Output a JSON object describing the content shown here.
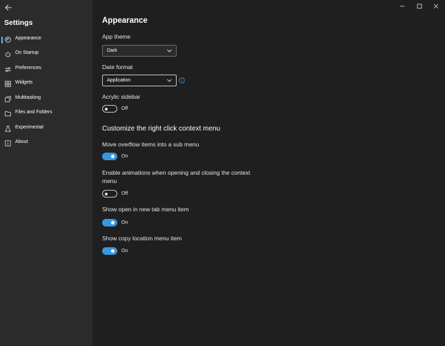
{
  "sidebar": {
    "title": "Settings",
    "items": [
      {
        "label": "Appearance",
        "icon": "appearance-icon"
      },
      {
        "label": "On Startup",
        "icon": "power-icon"
      },
      {
        "label": "Preferences",
        "icon": "sliders-icon"
      },
      {
        "label": "Widgets",
        "icon": "widgets-icon"
      },
      {
        "label": "Multitasking",
        "icon": "multitasking-icon"
      },
      {
        "label": "Files and Folders",
        "icon": "folder-icon"
      },
      {
        "label": "Experimental",
        "icon": "flask-icon"
      },
      {
        "label": "About",
        "icon": "info-square-icon"
      }
    ],
    "selected_index": 0
  },
  "main": {
    "heading": "Appearance",
    "app_theme": {
      "label": "App theme",
      "value": "Dark"
    },
    "date_format": {
      "label": "Date format",
      "value": "Application"
    },
    "acrylic": {
      "label": "Acrylic sidebar",
      "state": "Off"
    },
    "context_heading": "Customize the right click context menu",
    "settings": [
      {
        "label": "Move overflow items into a sub menu",
        "state": "On"
      },
      {
        "label_line1": "Enable animations when opening and closing the context",
        "label_line2": "menu",
        "state": "Off"
      },
      {
        "label": "Show open in new tab menu item",
        "state": "On"
      },
      {
        "label": "Show copy location menu item",
        "state": "On"
      }
    ]
  },
  "colors": {
    "accent": "#3a96dd",
    "selection_bar": "#4cc2ff",
    "background": "#1f1f1f",
    "sidebar": "#2b2b2b"
  }
}
